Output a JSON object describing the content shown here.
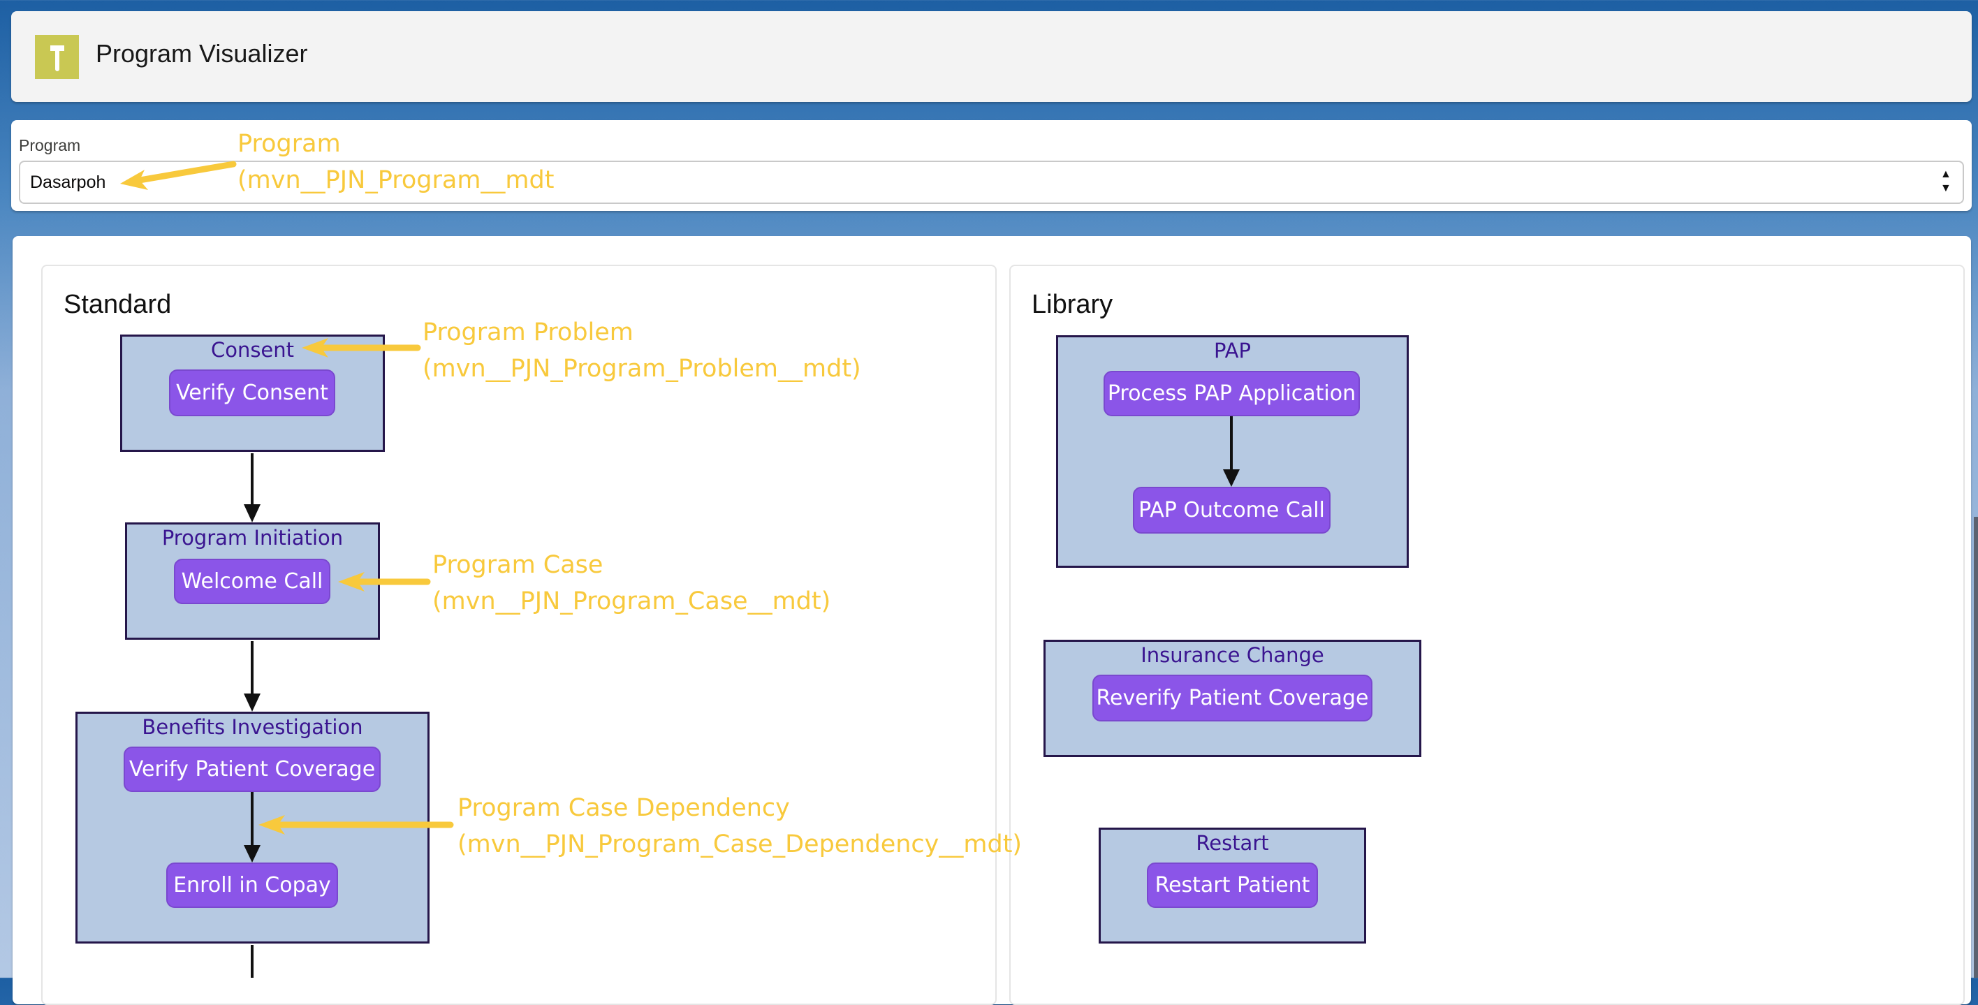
{
  "header": {
    "title": "Program Visualizer",
    "icon": "hammer-icon",
    "icon_color": "#c9c853"
  },
  "program_selector": {
    "label": "Program",
    "value": "Dasarpoh"
  },
  "annotations": {
    "program": [
      "Program",
      "(mvn__PJN_Program__mdt"
    ],
    "program_problem": [
      "Program Problem",
      "(mvn__PJN_Program_Problem__mdt)"
    ],
    "program_case": [
      "Program Case",
      "(mvn__PJN_Program_Case__mdt)"
    ],
    "program_case_dependency": [
      "Program Case Dependency",
      "(mvn__PJN_Program_Case_Dependency__mdt)"
    ]
  },
  "standard": {
    "title": "Standard",
    "stages": [
      {
        "name": "Consent",
        "cases": [
          "Verify Consent"
        ]
      },
      {
        "name": "Program Initiation",
        "cases": [
          "Welcome Call"
        ]
      },
      {
        "name": "Benefits Investigation",
        "cases": [
          "Verify Patient Coverage",
          "Enroll in Copay"
        ]
      }
    ]
  },
  "library": {
    "title": "Library",
    "stages": [
      {
        "name": "PAP",
        "cases": [
          "Process PAP Application",
          "PAP Outcome Call"
        ]
      },
      {
        "name": "Insurance Change",
        "cases": [
          "Reverify Patient Coverage"
        ]
      },
      {
        "name": "Restart",
        "cases": [
          "Restart Patient"
        ]
      }
    ]
  },
  "colors": {
    "stage_fill": "#b6c9e2",
    "case_fill": "#8b55e8",
    "annotation": "#f8c93c",
    "stage_label": "#3a1490"
  }
}
